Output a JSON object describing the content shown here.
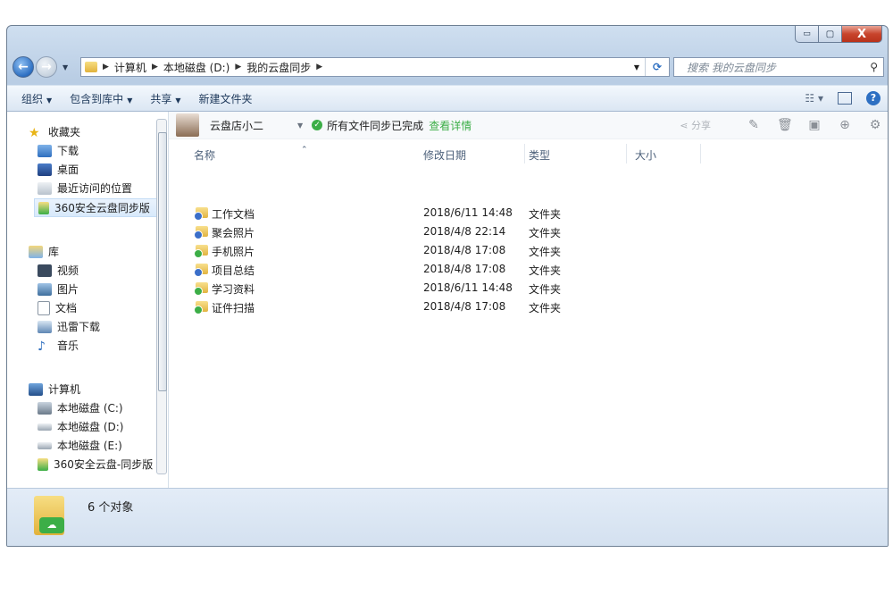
{
  "window": {
    "min_glyph": "▭",
    "max_glyph": "▢",
    "close_glyph": "X"
  },
  "address": {
    "crumbs": [
      "计算机",
      "本地磁盘 (D:)",
      "我的云盘同步"
    ],
    "search_placeholder": "搜索 我的云盘同步"
  },
  "toolbar": {
    "organize": "组织",
    "include_library": "包含到库中",
    "share": "共享",
    "new_folder": "新建文件夹"
  },
  "nav": {
    "favorites": "收藏夹",
    "downloads": "下载",
    "desktop": "桌面",
    "recent": "最近访问的位置",
    "sync360": "360安全云盘同步版",
    "libraries": "库",
    "videos": "视频",
    "pictures": "图片",
    "documents": "文档",
    "xunlei": "迅雷下载",
    "music": "音乐",
    "computer": "计算机",
    "drive_c": "本地磁盘 (C:)",
    "drive_d": "本地磁盘 (D:)",
    "drive_e": "本地磁盘 (E:)",
    "sync360b": "360安全云盘-同步版"
  },
  "syncbar": {
    "user": "云盘店小二",
    "status": "所有文件同步已完成",
    "details_link": "查看详情",
    "share": "分享"
  },
  "columns": {
    "name": "名称",
    "modified": "修改日期",
    "type": "类型",
    "size": "大小"
  },
  "files": [
    {
      "name": "工作文档",
      "modified": "2018/6/11 14:48",
      "type": "文件夹",
      "badge": "#3b6fc9"
    },
    {
      "name": "聚会照片",
      "modified": "2018/4/8 22:14",
      "type": "文件夹",
      "badge": "#3b6fc9"
    },
    {
      "name": "手机照片",
      "modified": "2018/4/8 17:08",
      "type": "文件夹",
      "badge": "#3cae47"
    },
    {
      "name": "项目总结",
      "modified": "2018/4/8 17:08",
      "type": "文件夹",
      "badge": "#3b6fc9"
    },
    {
      "name": "学习资料",
      "modified": "2018/6/11 14:48",
      "type": "文件夹",
      "badge": "#3cae47"
    },
    {
      "name": "证件扫描",
      "modified": "2018/4/8 17:08",
      "type": "文件夹",
      "badge": "#3cae47"
    }
  ],
  "statusbar": {
    "count": "6 个对象"
  },
  "colors": {
    "accent": "#3cae47",
    "link": "#3cae47",
    "selection": "#d8e9fb"
  }
}
